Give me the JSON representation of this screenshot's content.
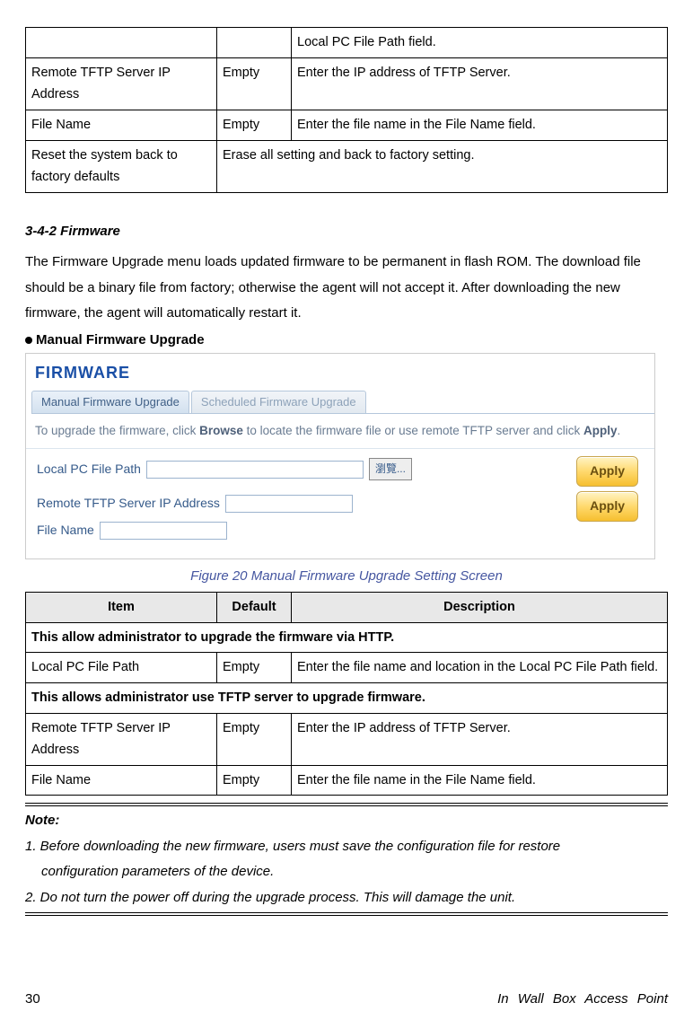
{
  "topTable": {
    "rows": [
      {
        "item": "",
        "default": "",
        "desc": "Local PC File Path field."
      },
      {
        "item": "Remote TFTP Server IP Address",
        "default": "Empty",
        "desc": "Enter the IP address of TFTP Server."
      },
      {
        "item": "File Name",
        "default": "Empty",
        "desc": "Enter the file name in the File Name field."
      },
      {
        "item": "Reset the system back to factory defaults",
        "default_desc": "Erase all setting and back to factory setting."
      }
    ]
  },
  "sectionHeading": "3-4-2        Firmware",
  "introPara": "The Firmware Upgrade menu loads updated firmware to be permanent in flash ROM. The download file should be a binary file from factory; otherwise the agent will not accept it. After downloading the new firmware, the agent will automatically restart it.",
  "bulletHeading": "Manual Firmware Upgrade",
  "firmwareBox": {
    "title": "FIRMWARE",
    "tab1": "Manual Firmware Upgrade",
    "tab2": "Scheduled Firmware Upgrade",
    "instrPre": "To upgrade the firmware, click ",
    "instrB1": "Browse",
    "instrMid": " to locate the firmware file or use remote TFTP server and click ",
    "instrB2": "Apply",
    "instrPost": ".",
    "lbl1": "Local PC File Path",
    "browse": "瀏覽...",
    "apply": "Apply",
    "lbl2": "Remote TFTP Server IP Address",
    "lbl3": "File Name"
  },
  "figCaption": "Figure 20 Manual Firmware Upgrade Setting Screen",
  "mainTable": {
    "h1": "Item",
    "h2": "Default",
    "h3": "Description",
    "span1": "This allow administrator to upgrade the firmware via HTTP.",
    "r1": {
      "item": "Local PC File Path",
      "def": "Empty",
      "desc": "Enter the file name and location in the Local PC File Path field."
    },
    "span2": "This allows administrator use TFTP server to upgrade firmware.",
    "r2": {
      "item": "Remote TFTP Server IP Address",
      "def": "Empty",
      "desc": "Enter the IP address of TFTP Server."
    },
    "r3": {
      "item": "File Name",
      "def": "Empty",
      "desc": "Enter the file name in the File Name field."
    }
  },
  "note": {
    "head": "Note:",
    "l1": "1. Before downloading the new firmware, users must save the configuration file for restore",
    "l1b": "configuration parameters of the device.",
    "l2": "2. Do not turn the power off during the upgrade process. This will damage the unit."
  },
  "footer": {
    "page": "30",
    "right": "In Wall Box Access Point"
  }
}
